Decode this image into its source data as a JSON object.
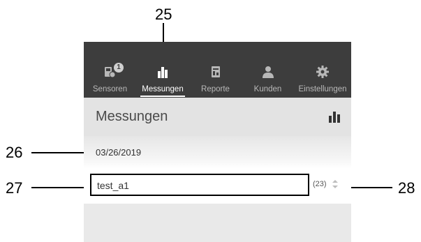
{
  "callouts": {
    "c25": "25",
    "c26": "26",
    "c27": "27",
    "c28": "28"
  },
  "tabs": [
    {
      "label": "Sensoren",
      "icon": "sensor-icon",
      "badge": "1",
      "active": false
    },
    {
      "label": "Messungen",
      "icon": "bar-chart-icon",
      "active": true
    },
    {
      "label": "Reporte",
      "icon": "report-icon",
      "active": false
    },
    {
      "label": "Kunden",
      "icon": "customer-icon",
      "active": false
    },
    {
      "label": "Einstellungen",
      "icon": "gear-icon",
      "active": false
    }
  ],
  "header": {
    "title": "Messungen",
    "chart_button_icon": "bar-chart-icon"
  },
  "date_group": {
    "date": "03/26/2019"
  },
  "list": {
    "items": [
      {
        "name": "test_a1",
        "count": "(23)",
        "sort_icon": "sort-icon"
      }
    ]
  },
  "colors": {
    "tabbar_bg": "#3d3d3d",
    "header_bg": "#e3e3e3",
    "active_tab": "#ffffff",
    "inactive_tab": "#b8b8b8"
  }
}
